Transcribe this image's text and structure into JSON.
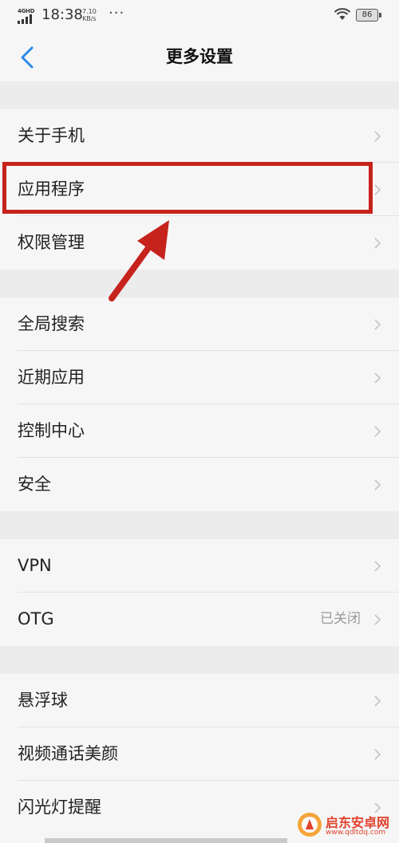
{
  "status_bar": {
    "network": "4G",
    "network_sub": "HD",
    "time": "18:38",
    "speed_top": "7.10",
    "speed_bottom": "KB/s",
    "more": "···",
    "battery": "86"
  },
  "header": {
    "title": "更多设置",
    "back_icon": "chevron-left-icon"
  },
  "groups": [
    {
      "items": [
        {
          "label": "关于手机"
        },
        {
          "label": "应用程序"
        },
        {
          "label": "权限管理"
        }
      ]
    },
    {
      "items": [
        {
          "label": "全局搜索"
        },
        {
          "label": "近期应用"
        },
        {
          "label": "控制中心"
        },
        {
          "label": "安全"
        }
      ]
    },
    {
      "items": [
        {
          "label": "VPN"
        },
        {
          "label": "OTG",
          "value": "已关闭"
        }
      ]
    },
    {
      "items": [
        {
          "label": "悬浮球"
        },
        {
          "label": "视频通话美颜"
        },
        {
          "label": "闪光灯提醒"
        }
      ]
    }
  ],
  "watermark": {
    "title": "启东安卓网",
    "url": "www.qdltdq.com"
  },
  "colors": {
    "accent": "#2a8ae6",
    "annotation": "#c6231c",
    "watermark": "#e2422d"
  }
}
